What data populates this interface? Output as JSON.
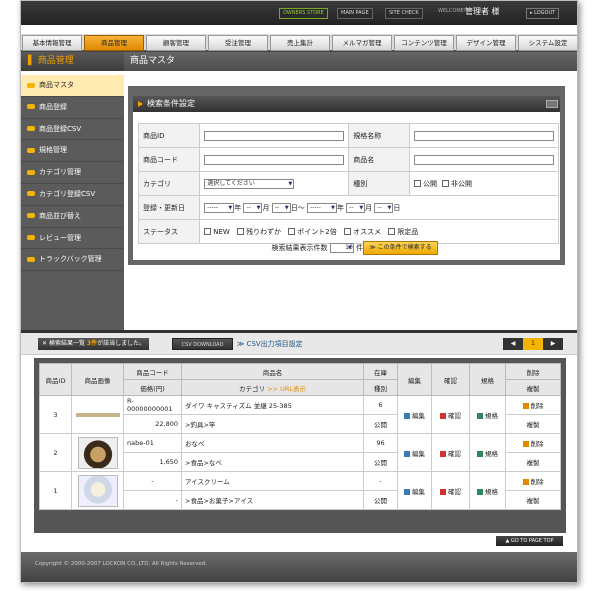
{
  "topbar": {
    "owners_store": "OWNERS STORE",
    "main_page": "MAIN PAGE",
    "site_check": "SITE CHECK",
    "welcome": "WELCOME!",
    "admin": "管理者 様",
    "logout": "LOGOUT"
  },
  "gnav": [
    "基本情報管理",
    "商品管理",
    "顧客管理",
    "受注管理",
    "売上集計",
    "メルマガ管理",
    "コンテンツ管理",
    "デザイン管理",
    "システム設定"
  ],
  "side_title": "商品管理",
  "content_title": "商品マスタ",
  "side_items": [
    "商品マスタ",
    "商品登録",
    "商品登録CSV",
    "規格管理",
    "カテゴリ管理",
    "カテゴリ登録CSV",
    "商品並び替え",
    "レビュー管理",
    "トラックバック管理"
  ],
  "search": {
    "title": "検索条件設定",
    "labels": {
      "id": "商品ID",
      "spec": "規格名称",
      "code": "商品コード",
      "name": "商品名",
      "category": "カテゴリ",
      "kind": "種別",
      "date": "登録・更新日",
      "status": "ステータス"
    },
    "category_default": "選択してください",
    "kind_options": [
      "公開",
      "非公開"
    ],
    "date_dash": "-----",
    "date_dd": "--",
    "units": {
      "y": "年",
      "m": "月",
      "d": "日",
      "tilde": "日〜"
    },
    "status_options": [
      "NEW",
      "残りわずか",
      "ポイント2倍",
      "オススメ",
      "限定品"
    ],
    "per_page_label": "検索結果表示件数",
    "per_page_value": "10",
    "per_page_unit": "件",
    "search_button": "≫ この条件で検索する"
  },
  "results": {
    "msg_a": "検索結果一覧",
    "count": "3件",
    "msg_b": "が該当しました。",
    "csv_button": "CSV DOWNLOAD",
    "csv_setting": "≫ CSV出力項目設定",
    "pager": [
      "◀",
      "1",
      "▶"
    ]
  },
  "table": {
    "headers": {
      "id": "商品ID",
      "image": "商品画像",
      "code": "商品コード",
      "price": "価格(円)",
      "name": "商品名",
      "category": "カテゴリ",
      "url": ">> URL表示",
      "stock": "在庫",
      "kind": "種別",
      "edit": "編集",
      "confirm": "確認",
      "spec": "規格",
      "delete": "削除",
      "copy": "複製"
    },
    "rows": [
      {
        "id": "3",
        "code": "R-00000000001",
        "price": "22,800",
        "name": "ダイワ キャスティズム 並継 25-385",
        "category": ">釣具>竿",
        "stock": "6",
        "kind": "公開",
        "edit": "編集",
        "confirm": "確認",
        "spec": "規格",
        "delete": "削除",
        "copy": "複製"
      },
      {
        "id": "2",
        "code": "nabe-01",
        "price": "1,650",
        "name": "おなべ",
        "category": ">食品>なべ",
        "stock": "96",
        "kind": "公開",
        "edit": "編集",
        "confirm": "確認",
        "spec": "規格",
        "delete": "削除",
        "copy": "複製"
      },
      {
        "id": "1",
        "code": "-",
        "price": "-",
        "name": "アイスクリーム",
        "category": ">食品>お菓子>アイス",
        "stock": "-",
        "kind": "公開",
        "edit": "編集",
        "confirm": "確認",
        "spec": "規格",
        "delete": "削除",
        "copy": "複製"
      }
    ]
  },
  "go_top": "GO TO PAGE TOP",
  "copyright": "Copyright © 2000-2007 LOCKON CO.,LTD. All Rights Reserved."
}
